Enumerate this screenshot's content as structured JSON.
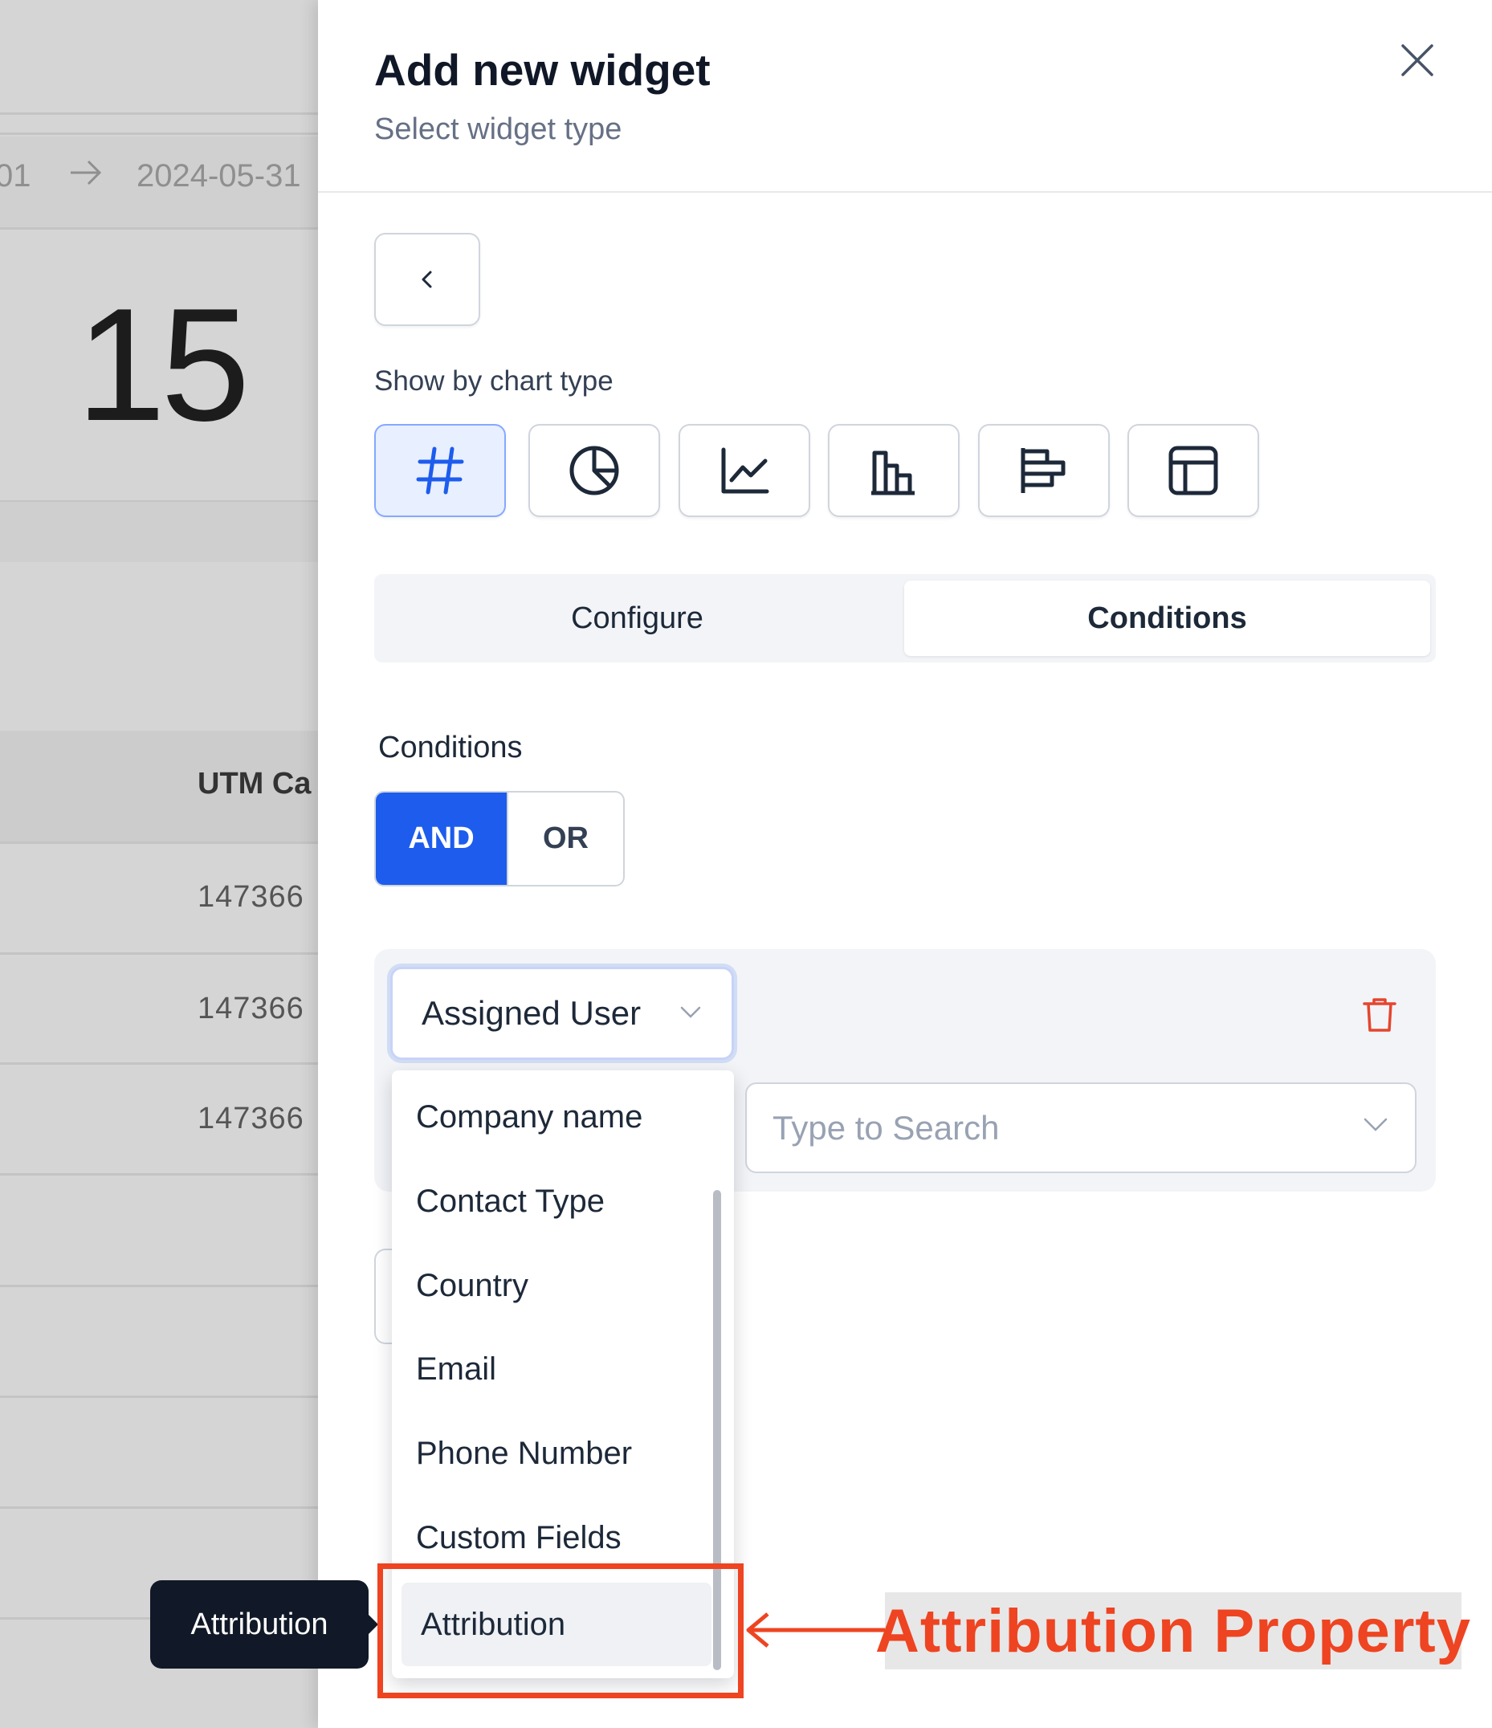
{
  "background": {
    "date_start": "01",
    "date_end": "2024-05-31",
    "kpi_value": "15",
    "table_header": "UTM Ca",
    "table_rows": [
      "147366",
      "147366",
      "147366"
    ]
  },
  "tooltip": {
    "text": "Attribution"
  },
  "panel": {
    "title": "Add new widget",
    "subtitle": "Select widget type",
    "chart_type_label": "Show by chart type",
    "chart_types": [
      {
        "icon": "hash-icon",
        "active": true
      },
      {
        "icon": "pie-chart-icon",
        "active": false
      },
      {
        "icon": "line-chart-icon",
        "active": false
      },
      {
        "icon": "bar-chart-icon",
        "active": false
      },
      {
        "icon": "horizontal-bar-chart-icon",
        "active": false
      },
      {
        "icon": "table-icon",
        "active": false
      }
    ],
    "tabs": [
      {
        "label": "Configure",
        "active": false
      },
      {
        "label": "Conditions",
        "active": true
      }
    ],
    "conditions_label": "Conditions",
    "logic": {
      "and": "AND",
      "or": "OR",
      "selected": "AND"
    },
    "condition": {
      "field_value": "Assigned User",
      "search_placeholder": "Type to Search"
    },
    "dropdown_options": [
      "Company name",
      "Contact Type",
      "Country",
      "Email",
      "Phone Number",
      "Custom Fields",
      "Attribution"
    ],
    "highlighted_option": "Attribution"
  },
  "annotation": {
    "label": "Attribution Property",
    "color": "#ee4421"
  },
  "colors": {
    "primary": "#1d5ced",
    "danger": "#e5452f",
    "tab_bg": "#f2f4f7"
  }
}
